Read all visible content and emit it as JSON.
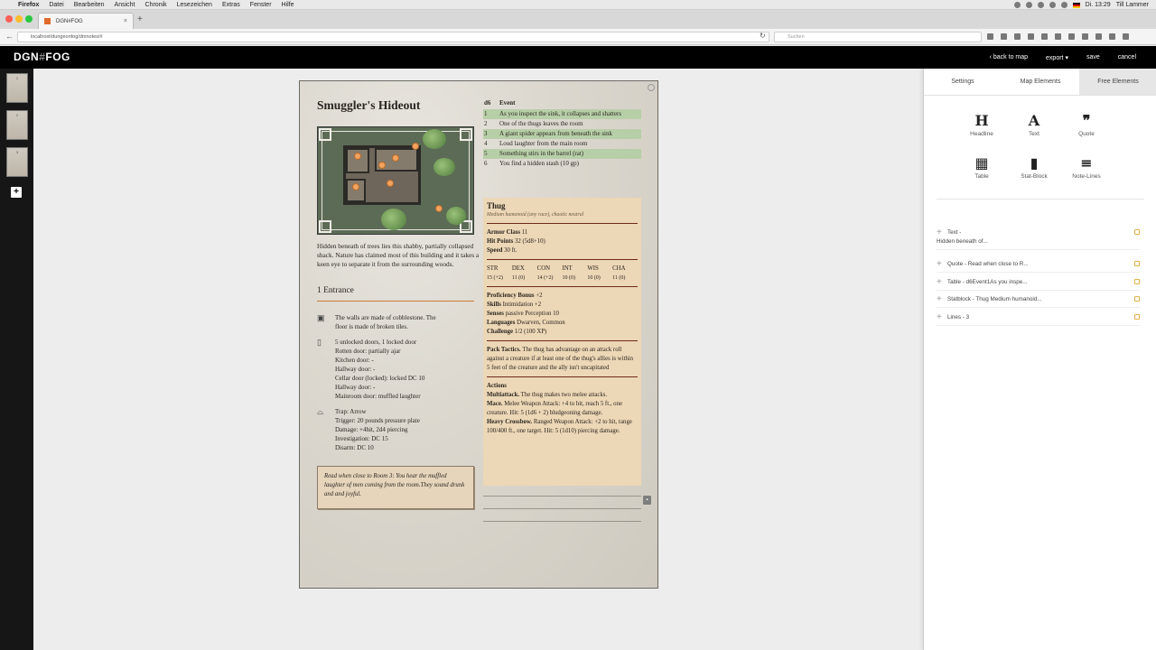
{
  "macbar": {
    "menus": [
      "Firefox",
      "Datei",
      "Bearbeiten",
      "Ansicht",
      "Chronik",
      "Lesezeichen",
      "Extras",
      "Fenster",
      "Hilfe"
    ],
    "clock": "Di. 13:29",
    "user": "Till Lammer"
  },
  "browser": {
    "tab_title": "DGN#FOG",
    "url": "localhost/dungeonfog/dmnotes/#",
    "search_placeholder": "Suchen"
  },
  "app": {
    "logo_main": "DGN",
    "logo_tail": "FOG",
    "header_buttons": {
      "back": "back to map",
      "export": "export",
      "save": "save",
      "cancel": "cancel"
    },
    "page_thumbs": [
      "1",
      "2",
      "3"
    ],
    "add_page": "+"
  },
  "document": {
    "title": "Smuggler's Hideout",
    "intro": "Hidden beneath of trees lies this shabby, partially collapsed shack. Nature has claimed most of this building and it takes a keen eye to separate it from the surrounding woods.",
    "section": "1  Entrance",
    "walls": {
      "line1": "The walls are made of cobblestone. The",
      "line2": "floor is made of broken tiles."
    },
    "doors": [
      "5 unlocked doors, 1 locked door",
      "Rotten door: partially ajar",
      "Kitchen door: -",
      "Hallway door: -",
      "Cellar door (locked): locked DC 10",
      "Hallway door: -",
      "Mainroom door: muffled laughter"
    ],
    "trap": [
      "Trap: Arrow",
      "Trigger: 20 pounds pressure plate",
      "Damage: +4hit, 2d4 piercing",
      "Investigation: DC 15",
      "Disarm: DC 10"
    ],
    "read_aloud": "Read when close to Room 3: You hear the muffled laughter of men coming from the room.They sound drunk and and joyful.",
    "event_table": {
      "head_die": "d6",
      "head_event": "Event",
      "rows": [
        {
          "num": "1",
          "text": "As you inspect the sink, it collapses and shatters"
        },
        {
          "num": "2",
          "text": "One of the thugs leaves the room"
        },
        {
          "num": "3",
          "text": "A giant spider appears from beneath the sink"
        },
        {
          "num": "4",
          "text": "Loud laughter from the main room"
        },
        {
          "num": "5",
          "text": "Something stirs in the barrel (rat)"
        },
        {
          "num": "6",
          "text": "You find a hidden stash (10 gp)"
        }
      ]
    },
    "statblock": {
      "name": "Thug",
      "subtitle": "Medium humanoid (any race), chaotic neutral",
      "armor_label": "Armor Class",
      "armor": "11",
      "hp_label": "Hit Points",
      "hp": "32 (5d8+10)",
      "speed_label": "Speed",
      "speed": "30 ft.",
      "abilities": [
        {
          "name": "STR",
          "val": "15 (+2)"
        },
        {
          "name": "DEX",
          "val": "11 (0)"
        },
        {
          "name": "CON",
          "val": "14 (+2)"
        },
        {
          "name": "INT",
          "val": "10 (0)"
        },
        {
          "name": "WIS",
          "val": "10 (0)"
        },
        {
          "name": "CHA",
          "val": "11 (0)"
        }
      ],
      "prof_label": "Proficiency Bonus",
      "prof": "+2",
      "skills_label": "Skills",
      "skills": "Intimidation +2",
      "senses_label": "Senses",
      "senses": "passive Perception 10",
      "lang_label": "Languages",
      "lang": "Dwarven, Common",
      "cr_label": "Challenge",
      "cr": "1/2 (100 XP)",
      "pack_label": "Pack Tactics.",
      "pack": "The thug has advantage on an attack roll against a creature if at least one of the thug's allies is within 5 feet of the creature and the ally isn't uncapitated",
      "actions_label": "Actions",
      "multi_label": "Multiattack.",
      "multi": "The thug makes two melee attacks.",
      "mace_label": "Mace.",
      "mace": "Melee Weapon Attack: +4 to hit, reach 5 ft., one creature. Hit: 5 (1d6 + 2) bludgeoning damage.",
      "xbow_label": "Heavy Crossbow.",
      "xbow": "Ranged Weapon Attack: +2 to hit, range 100/400 ft., one target. Hit: 5 (1d10) piercing damage."
    }
  },
  "panel": {
    "tabs": [
      "Settings",
      "Map Elements",
      "Free Elements"
    ],
    "tools": [
      {
        "glyph": "H",
        "label": "Headline"
      },
      {
        "glyph": "A",
        "label": "Text"
      },
      {
        "glyph": "❞",
        "label": "Quote"
      },
      {
        "glyph": "▦",
        "label": "Table"
      },
      {
        "glyph": "▮",
        "label": "Stat-Block"
      },
      {
        "glyph": "≡",
        "label": "Note-Lines"
      }
    ],
    "elements": [
      {
        "line1": "Text -",
        "line2": "Hidden beneath of..."
      },
      {
        "line1": "Quote - Read when close to R..."
      },
      {
        "line1": "Table - d6Event1As you inspe..."
      },
      {
        "line1": "Statblock - Thug Medium humanoid..."
      },
      {
        "line1": "Lines - 3"
      }
    ]
  },
  "colors": {
    "accent_orange": "#e06a2c",
    "table_green": "#b7cfa7",
    "statblock_bg": "#ecd7b6",
    "statblock_rule": "#6f2a1c"
  }
}
